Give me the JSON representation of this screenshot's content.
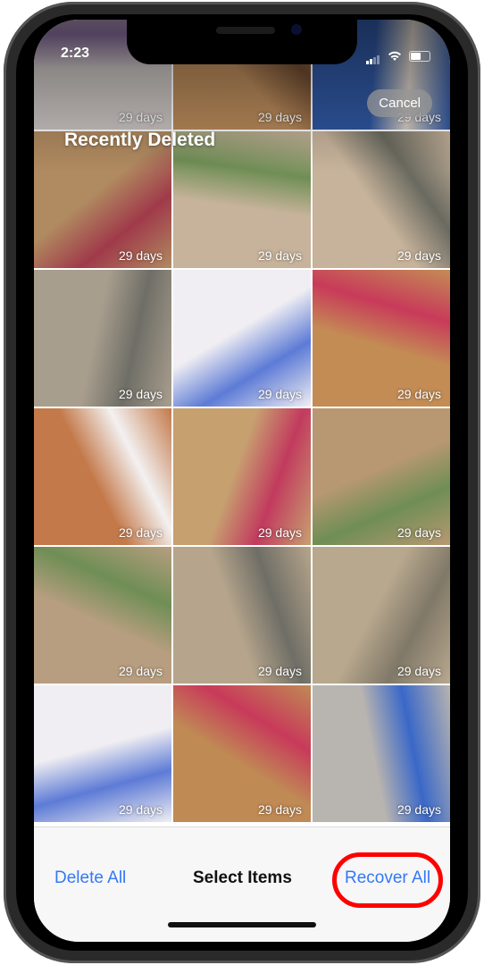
{
  "status": {
    "time": "2:23"
  },
  "header": {
    "title": "Recently Deleted",
    "cancel_label": "Cancel"
  },
  "grid": {
    "cells": [
      {
        "label": "29 days",
        "colors": [
          "#c9c3c0",
          "#8a6ea0"
        ]
      },
      {
        "label": "29 days",
        "colors": [
          "#b8895a",
          "#6d4a30"
        ]
      },
      {
        "label": "29 days",
        "colors": [
          "#2f56a0",
          "#d8cfc4"
        ]
      },
      {
        "label": "29 days",
        "colors": [
          "#b08a60",
          "#a03a4a"
        ]
      },
      {
        "label": "29 days",
        "colors": [
          "#c7b39b",
          "#6f8e55"
        ]
      },
      {
        "label": "29 days",
        "colors": [
          "#c7b39b",
          "#6a6a60"
        ]
      },
      {
        "label": "29 days",
        "colors": [
          "#a89e8e",
          "#6f6e66"
        ]
      },
      {
        "label": "29 days",
        "colors": [
          "#f0eef2",
          "#5d7bd6"
        ]
      },
      {
        "label": "29 days",
        "colors": [
          "#c48c55",
          "#c83a5a"
        ]
      },
      {
        "label": "29 days",
        "colors": [
          "#c4794a",
          "#f3f1f1"
        ]
      },
      {
        "label": "29 days",
        "colors": [
          "#c7a070",
          "#c23a5e"
        ]
      },
      {
        "label": "29 days",
        "colors": [
          "#b89872",
          "#6f8e55"
        ]
      },
      {
        "label": "29 days",
        "colors": [
          "#b89e80",
          "#6f8e55"
        ]
      },
      {
        "label": "29 days",
        "colors": [
          "#b6a58c",
          "#6f6e66"
        ]
      },
      {
        "label": "29 days",
        "colors": [
          "#b8a88e",
          "#807868"
        ]
      },
      {
        "label": "29 days",
        "colors": [
          "#f0eef2",
          "#5d7bd6"
        ]
      },
      {
        "label": "29 days",
        "colors": [
          "#c08a55",
          "#c83a5a"
        ]
      },
      {
        "label": "29 days",
        "colors": [
          "#b8b4b0",
          "#3a68c8"
        ]
      }
    ]
  },
  "toolbar": {
    "delete_all": "Delete All",
    "select_items": "Select Items",
    "recover_all": "Recover All",
    "highlight_color": "#ff0000",
    "accent_color": "#3478f6"
  }
}
